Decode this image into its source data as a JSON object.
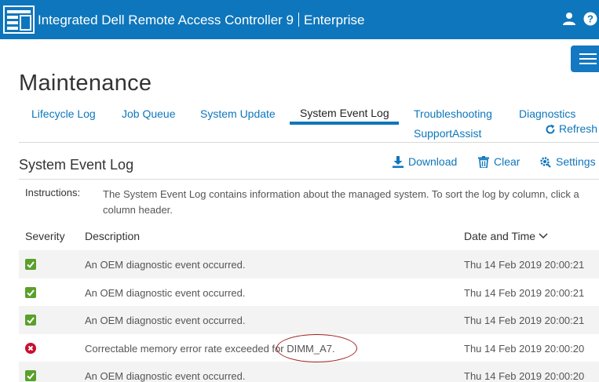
{
  "header": {
    "app_title": "Integrated Dell Remote Access Controller 9",
    "edition": "Enterprise",
    "brand_color": "#0e76bc",
    "icons": [
      "server-logo-icon",
      "user-icon",
      "help-icon"
    ]
  },
  "page": {
    "title": "Maintenance"
  },
  "tabs": [
    {
      "label": "Lifecycle Log"
    },
    {
      "label": "Job Queue"
    },
    {
      "label": "System Update"
    },
    {
      "label": "System Event Log",
      "active": true
    },
    {
      "label": "Troubleshooting"
    },
    {
      "label": "Diagnostics"
    },
    {
      "label": "SupportAssist"
    }
  ],
  "refresh_label": "Refresh",
  "section": {
    "title": "System Event Log",
    "actions": {
      "download": "Download",
      "clear": "Clear",
      "settings": "Settings"
    }
  },
  "instructions": {
    "label": "Instructions:",
    "text": "The System Event Log contains information about the managed system. To sort the log by column, click a column header."
  },
  "table": {
    "columns": {
      "severity": "Severity",
      "description": "Description",
      "datetime": "Date and Time"
    },
    "sort": {
      "column": "datetime",
      "direction": "descending"
    },
    "rows": [
      {
        "severity": "ok",
        "description": "An OEM diagnostic event occurred.",
        "datetime": "Thu 14 Feb 2019 20:00:21"
      },
      {
        "severity": "ok",
        "description": "An OEM diagnostic event occurred.",
        "datetime": "Thu 14 Feb 2019 20:00:21"
      },
      {
        "severity": "ok",
        "description": "An OEM diagnostic event occurred.",
        "datetime": "Thu 14 Feb 2019 20:00:21"
      },
      {
        "severity": "critical",
        "description": "Correctable memory error rate exceeded for DIMM_A7.",
        "datetime": "Thu 14 Feb 2019 20:00:20"
      },
      {
        "severity": "ok",
        "description": "An OEM diagnostic event occurred.",
        "datetime": "Thu 14 Feb 2019 20:00:20"
      }
    ]
  },
  "colors": {
    "ok": "#5aa02c",
    "critical": "#c8102e",
    "link": "#0e76bc",
    "annotation": "#a11f1f"
  }
}
